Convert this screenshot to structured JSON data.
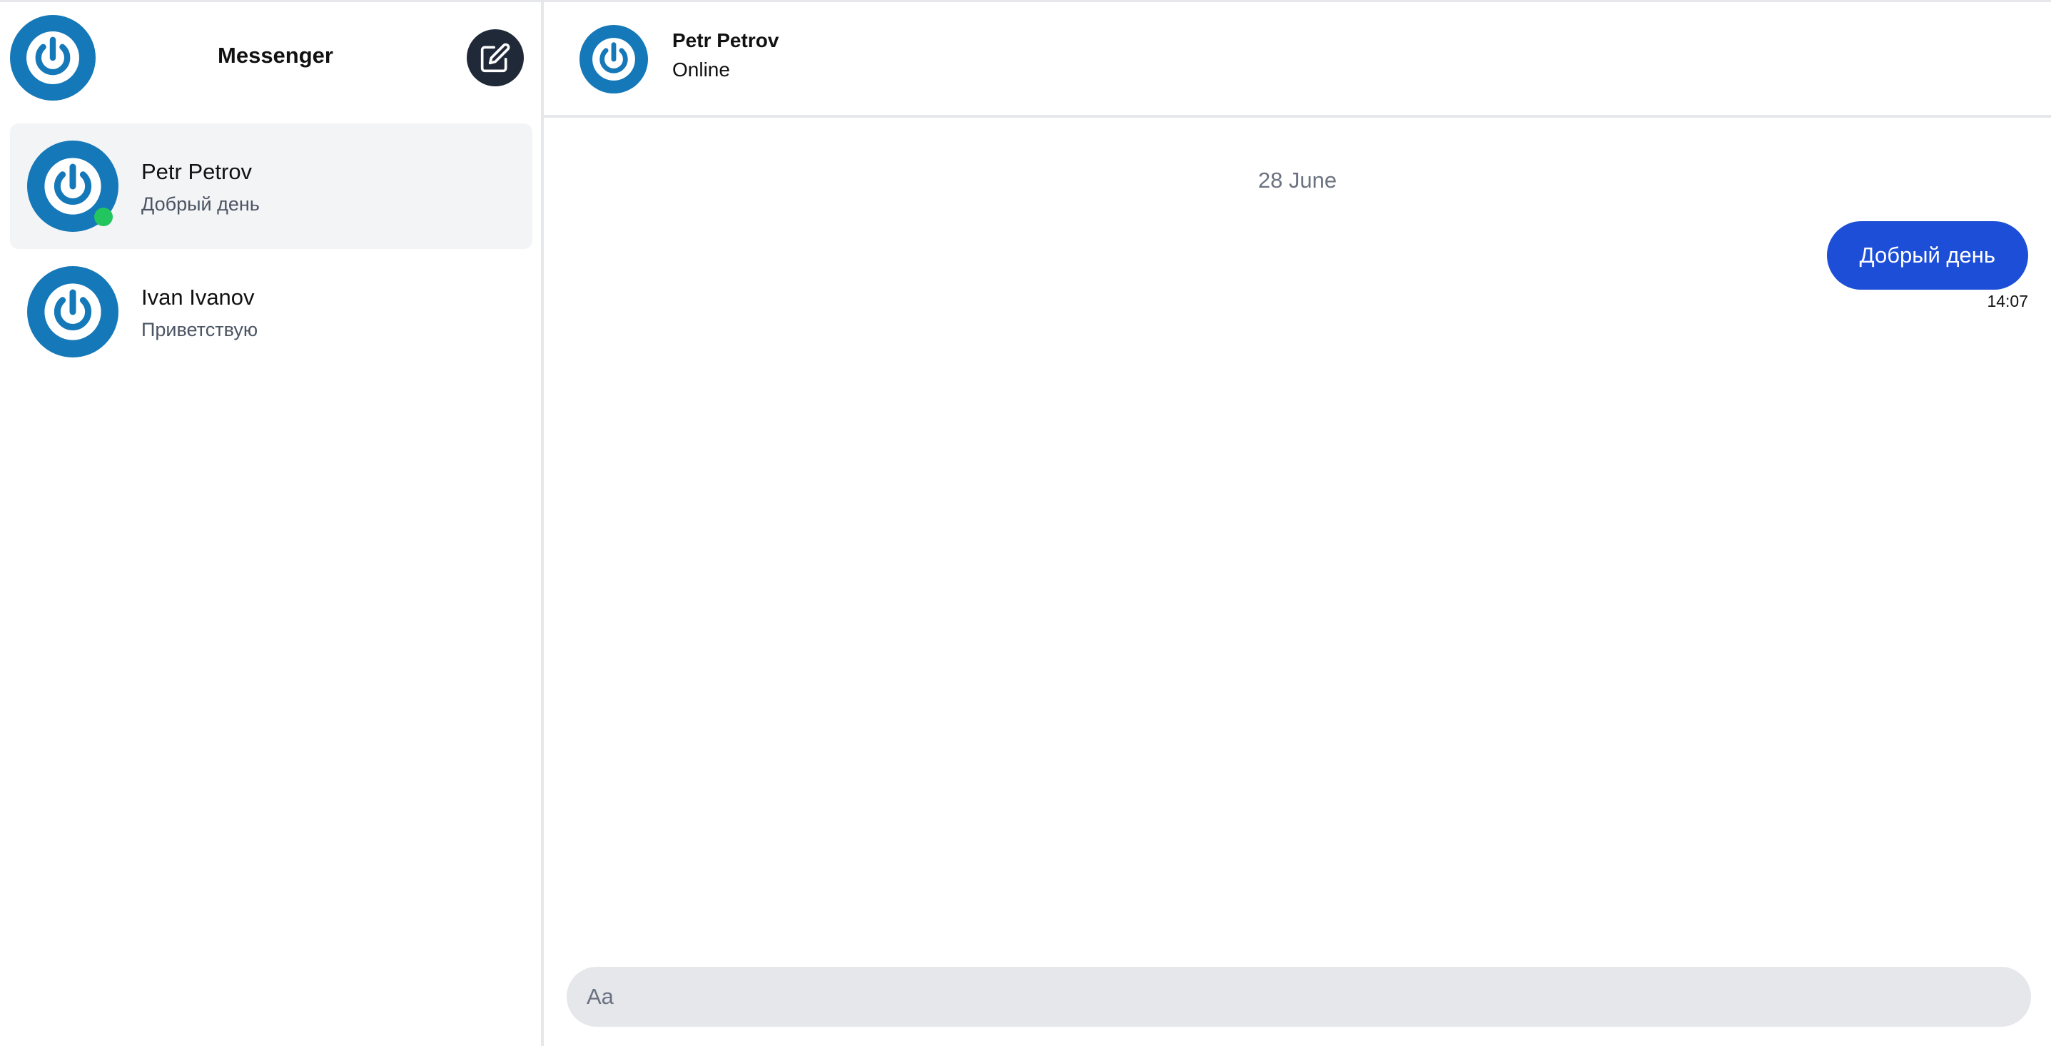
{
  "sidebar": {
    "title": "Messenger",
    "compose_icon": "compose-icon",
    "conversations": [
      {
        "name": "Petr Petrov",
        "preview": "Добрый день",
        "online": true,
        "active": true
      },
      {
        "name": "Ivan Ivanov",
        "preview": "Приветствую",
        "online": false,
        "active": false
      }
    ]
  },
  "chat": {
    "header": {
      "name": "Petr Petrov",
      "status": "Online"
    },
    "date_separator": "28 June",
    "messages": [
      {
        "text": "Добрый день",
        "time": "14:07",
        "outgoing": true
      }
    ],
    "composer": {
      "placeholder": "Aa",
      "value": ""
    }
  },
  "colors": {
    "accent": "#1d4ed8",
    "avatar": "#1578b8",
    "online": "#22c55e",
    "compose_button": "#1f2937",
    "active_row": "#f3f4f6"
  },
  "icons": {
    "avatar": "power-icon",
    "compose": "compose-icon"
  }
}
